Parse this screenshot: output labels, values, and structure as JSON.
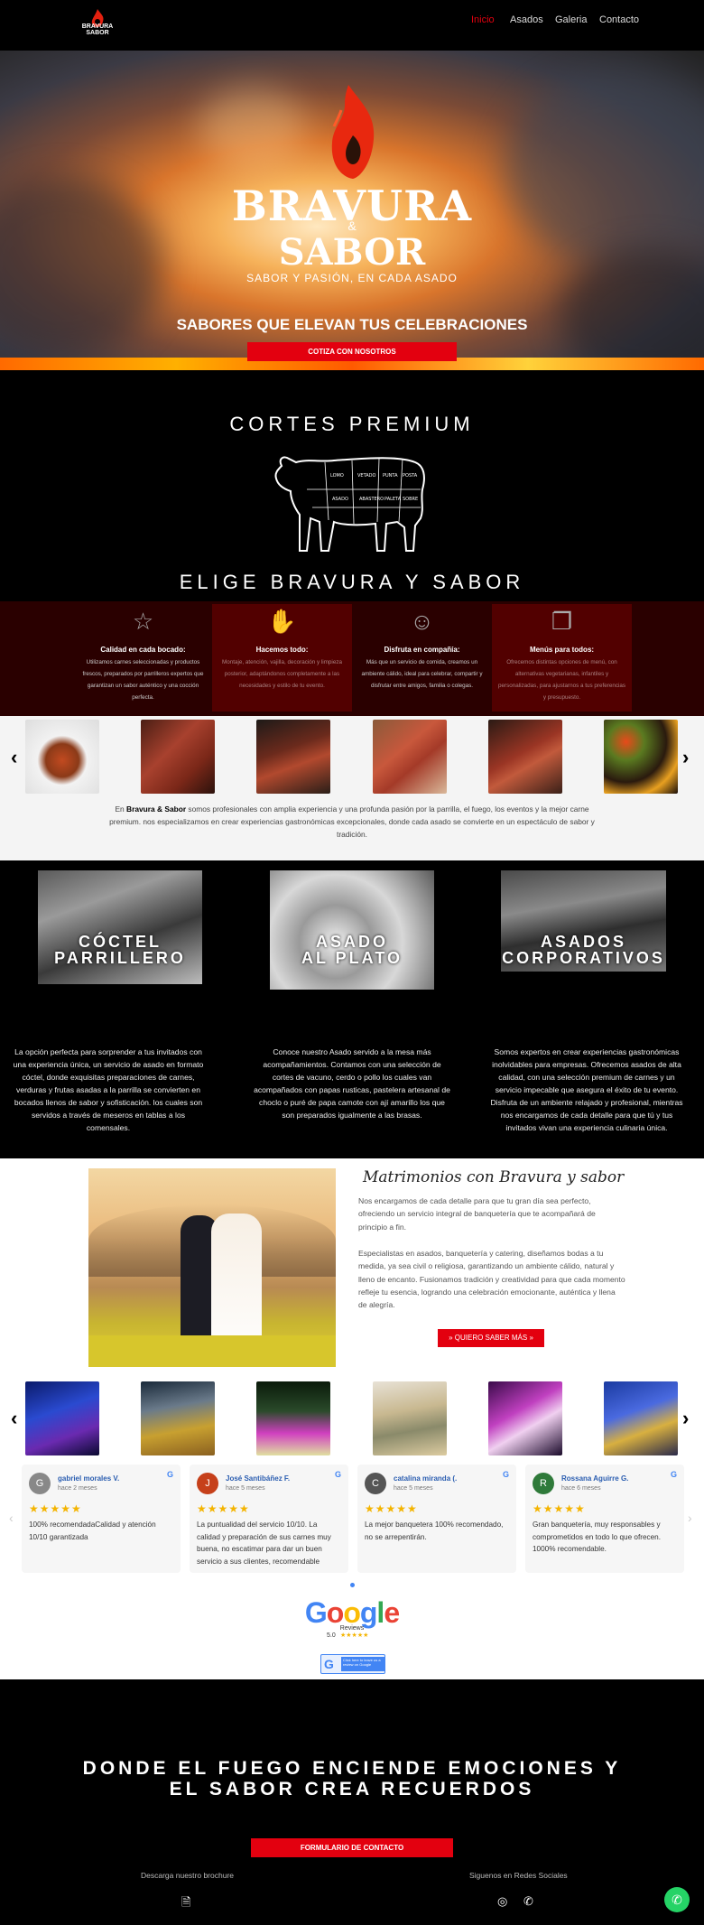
{
  "nav": {
    "logo_line1": "BRAVURA",
    "logo_line2": "SABOR",
    "items": [
      "Inicio",
      "Asados",
      "Galeria",
      "Contacto"
    ],
    "active": "Inicio"
  },
  "hero": {
    "brand_line1": "BRAVURA",
    "brand_amp": "&",
    "brand_line2": "SABOR",
    "tagline": "SABOR Y PASIÓN, EN CADA ASADO",
    "headline": "SABORES QUE ELEVAN TUS CELEBRACIONES",
    "cta": "COTIZA CON NOSOTROS"
  },
  "cortes": {
    "title": "CORTES PREMIUM",
    "subtitle": "ELIGE BRAVURA Y SABOR"
  },
  "features": [
    {
      "icon": "star-icon",
      "glyph": "☆",
      "title": "Calidad en cada bocado:",
      "text": "Utilizamos carnes seleccionadas y productos frescos, preparados por parrilleros expertos que garantizan un sabor auténtico y una cocción perfecta."
    },
    {
      "icon": "hand-icon",
      "glyph": "✋",
      "title": "Hacemos todo:",
      "text": "Montaje, atención, vajilla, decoración y limpieza posterior, adaptándonos completamente a las necesidades y estilo de tu evento."
    },
    {
      "icon": "smile-icon",
      "glyph": "☺",
      "title": "Disfruta en compañía:",
      "text": "Más que un servicio de comida, creamos un ambiente cálido, ideal para celebrar, compartir y disfrutar entre amigos, familia o colegas."
    },
    {
      "icon": "layers-icon",
      "glyph": "❐",
      "title": "Menús para todos:",
      "text": "Ofrecemos distintas opciones de menú, con alternativas vegetarianas, infantiles y personalizadas, para ajustarnos a tus preferencias y presupuesto."
    }
  ],
  "about": {
    "brand": "Bravura & Sabor",
    "text": " somos profesionales con amplia experiencia y una profunda pasión por la parrilla, el fuego, los eventos y la mejor carne premium. nos especializamos en crear experiencias gastronómicas excepcionales, donde cada asado se convierte en un espectáculo de sabor y tradición.",
    "prefix": "En "
  },
  "services": [
    {
      "label1": "CÓCTEL",
      "label2": "PARRILLERO",
      "text": "La opción perfecta para sorprender a tus invitados con una experiencia única, un servicio de asado en formato cóctel, donde exquisitas preparaciones de carnes, verduras y frutas asadas a la parrilla se convierten en bocados llenos de sabor y sofisticación. los cuales son servidos a través de meseros en tablas a los comensales."
    },
    {
      "label1": "ASADO",
      "label2": "AL PLATO",
      "text": "Conoce nuestro Asado servido a la mesa más acompañamientos. Contamos con una selección de cortes de vacuno, cerdo o pollo los cuales van acompañados con papas rusticas, pastelera artesanal de choclo o puré de papa camote con ají amarillo los que son preparados igualmente a las brasas."
    },
    {
      "label1": "ASADOS",
      "label2": "CORPORATIVOS",
      "text": "Somos expertos en crear experiencias gastronómicas inolvidables para empresas. Ofrecemos asados de alta calidad, con una selección premium de carnes y un servicio impecable que asegura el éxito de tu evento. Disfruta de un ambiente relajado y profesional, mientras nos encargamos de cada detalle para que tú y tus invitados vivan una experiencia culinaria única."
    }
  ],
  "wedding": {
    "title": "Matrimonios con Bravura y sabor",
    "p1": "Nos encargamos de cada detalle para que tu gran día sea perfecto, ofreciendo un servicio integral de banquetería que te acompañará de principio a fin.",
    "p2": "Especialistas en asados, banquetería y catering, diseñamos bodas a tu medida, ya sea civil o religiosa, garantizando un ambiente cálido, natural y lleno de encanto. Fusionamos tradición y creatividad para que cada momento refleje tu esencia, logrando una celebración emocionante, auténtica y llena de alegría.",
    "cta": "» QUIERO SABER MÁS »"
  },
  "reviews": [
    {
      "name": "gabriel morales V.",
      "when": "hace 2 meses",
      "initial": "G",
      "color": "#888",
      "text": "100% recomendadaCalidad y atención 10/10 garantizada",
      "rating": 5
    },
    {
      "name": "José Santibáñez F.",
      "when": "hace 5 meses",
      "initial": "J",
      "color": "#c6401a",
      "text": "La puntualidad del servicio 10/10. La calidad y preparación de sus carnes muy buena, no escatimar para dar un buen servicio a sus clientes, recomendable",
      "rating": 5
    },
    {
      "name": "catalina miranda (.",
      "when": "hace 5 meses",
      "initial": "C",
      "color": "#555",
      "text": "La mejor banquetera 100% recomendado, no se arrepentirán.",
      "rating": 5
    },
    {
      "name": "Rossana Aguirre G.",
      "when": "hace 6 meses",
      "initial": "R",
      "color": "#2f7a3a",
      "text": "Gran banquetería, muy responsables y comprometidos en todo lo que ofrecen. 1000% recomendable.",
      "rating": 5
    }
  ],
  "google": {
    "word": "Google",
    "reviews_label": "Reviews",
    "score": "5.0",
    "badge": "Click here to leave us a review on Google"
  },
  "footer": {
    "title": "DONDE EL FUEGO ENCIENDE EMOCIONES Y EL SABOR CREA RECUERDOS",
    "cta": "FORMULARIO DE CONTACTO",
    "brochure": "Descarga nuestro brochure",
    "social": "Siguenos en Redes Sociales"
  },
  "colors": {
    "accent": "#e3000f",
    "feature_bg": "#2a0000",
    "feature_dark": "#520000"
  }
}
